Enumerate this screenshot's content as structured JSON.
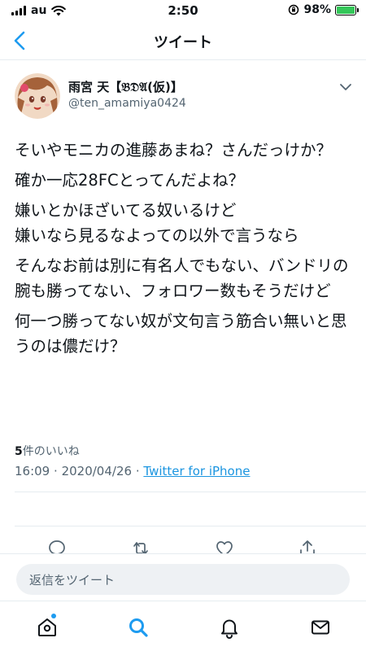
{
  "status_bar": {
    "carrier": "au",
    "time": "2:50",
    "battery_percent": "98%",
    "battery_level": 0.98
  },
  "header": {
    "title": "ツイート"
  },
  "tweet": {
    "display_name": "雨宮 天【𝔅𝔇𝔄(仮)】",
    "handle": "@ten_amamiya0424",
    "paragraphs": [
      "そいやモニカの進藤あまね？さんだっけか？",
      "確か一応28FCとってんだよね？",
      "嫌いとかほざいてる奴いるけど\n嫌いなら見るなよっての以外で言うなら",
      "そんなお前は別に有名人でもない、バンドリの腕も勝ってない、フォロワー数もそうだけど",
      "何一つ勝ってない奴が文句言う筋合い無いと思うのは儂だけ？"
    ],
    "time": "16:09",
    "date": "2020/04/26",
    "separator": "·",
    "source": "Twitter for iPhone",
    "likes_count": "5",
    "likes_label": "件のいいね"
  },
  "reply": {
    "placeholder": "返信をツイート"
  },
  "icons": {
    "accent_color": "#1d9bf0",
    "back": "chevron-left-icon",
    "more": "chevron-down-icon",
    "reply": "reply-icon",
    "retweet": "retweet-icon",
    "like": "heart-icon",
    "share": "share-icon",
    "home": "home-icon",
    "search": "search-icon",
    "notifications": "bell-icon",
    "messages": "mail-icon"
  }
}
